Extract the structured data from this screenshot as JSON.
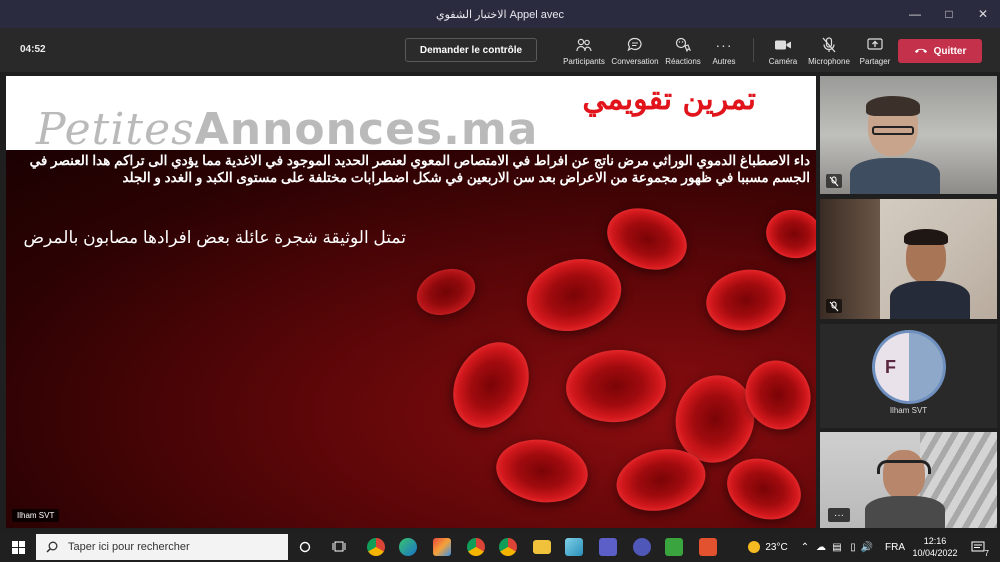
{
  "window": {
    "title": "الاختبار الشفوي Appel avec",
    "controls": [
      "minimize",
      "maximize",
      "close"
    ]
  },
  "toolbar": {
    "timer": "04:52",
    "request_control": "Demander le contrôle",
    "items": [
      {
        "label": "Participants",
        "icon": "participants-icon"
      },
      {
        "label": "Conversation",
        "icon": "chat-icon"
      },
      {
        "label": "Réactions",
        "icon": "reactions-icon"
      },
      {
        "label": "Autres",
        "icon": "more-icon"
      },
      {
        "label": "Caméra",
        "icon": "camera-icon"
      },
      {
        "label": "Microphone",
        "icon": "mic-off-icon"
      },
      {
        "label": "Partager",
        "icon": "share-icon"
      }
    ],
    "quit": "Quitter",
    "quit_color": "#c4314b"
  },
  "slide": {
    "title": "تمرين تقويمي",
    "watermark_a": "Petites",
    "watermark_b": "Annonces.ma",
    "paragraph1": "داء الاصطباغ الدموي الوراثي مرض ناتج عن افراط في الامتصاص المعوي لعنصر الحديد الموجود في الاغدية مما يؤدي الى تراكم هدا العنصر في الجسم مسببا في ظهور مجموعة من الاعراض بعد سن الاربعين في شكل اضطرابات مختلفة على مستوى الكبد و الغدد و الجلد",
    "paragraph2": "تمتل الوثيقة شجرة عائلة بعض افرادها مصابون بالمرض",
    "presenter": "Ilham SVT",
    "title_color": "#e0141a"
  },
  "participants": [
    {
      "kind": "video",
      "muted": true
    },
    {
      "kind": "video",
      "muted": true
    },
    {
      "kind": "avatar",
      "initial": "F",
      "name": "Ilham SVT"
    },
    {
      "kind": "video",
      "more": "···"
    }
  ],
  "taskbar": {
    "search_placeholder": "Taper ici pour rechercher",
    "temperature": "23°C",
    "language": "FRA",
    "time": "12:16",
    "date": "10/04/2022",
    "notification_count": "7"
  }
}
